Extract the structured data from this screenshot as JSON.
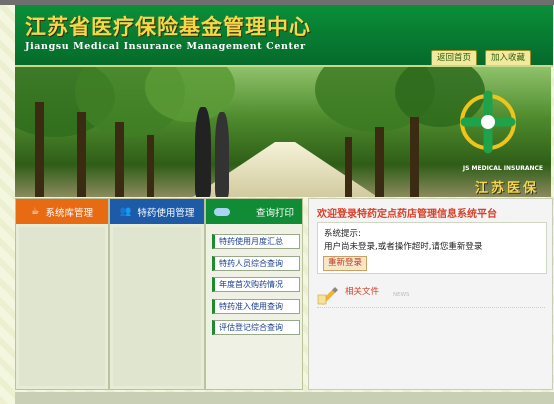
{
  "header": {
    "title_cn": "江苏省医疗保险基金管理中心",
    "title_en": "Jiangsu Medical Insurance Management Center",
    "links": [
      "返回首页",
      "加入收藏"
    ]
  },
  "banner": {
    "logo_en": "JS MEDICAL INSURANCE",
    "logo_cn": "江苏医保"
  },
  "nav_columns": [
    {
      "label": "系统库管理",
      "icon": "cup-icon",
      "color": "#e86a13"
    },
    {
      "label": "特药使用管理",
      "icon": "people-icon",
      "color": "#1d5aa7"
    },
    {
      "label": "查询打印",
      "icon": "capsule-icon",
      "color": "#0f8c35"
    }
  ],
  "query_links": [
    "特药使用月度汇总",
    "特药人员综合查询",
    "年度首次购药情况",
    "特药准入使用查询",
    "评估登记综合查询"
  ],
  "main": {
    "welcome": "欢迎登录特药定点药店管理信息系统平台",
    "notice_title": "系统提示:",
    "notice_text": "用户尚未登录,或者操作超时,请您重新登录",
    "relogin_label": "重新登录",
    "related_label": "相关文件",
    "news_tag": "NEWS"
  }
}
